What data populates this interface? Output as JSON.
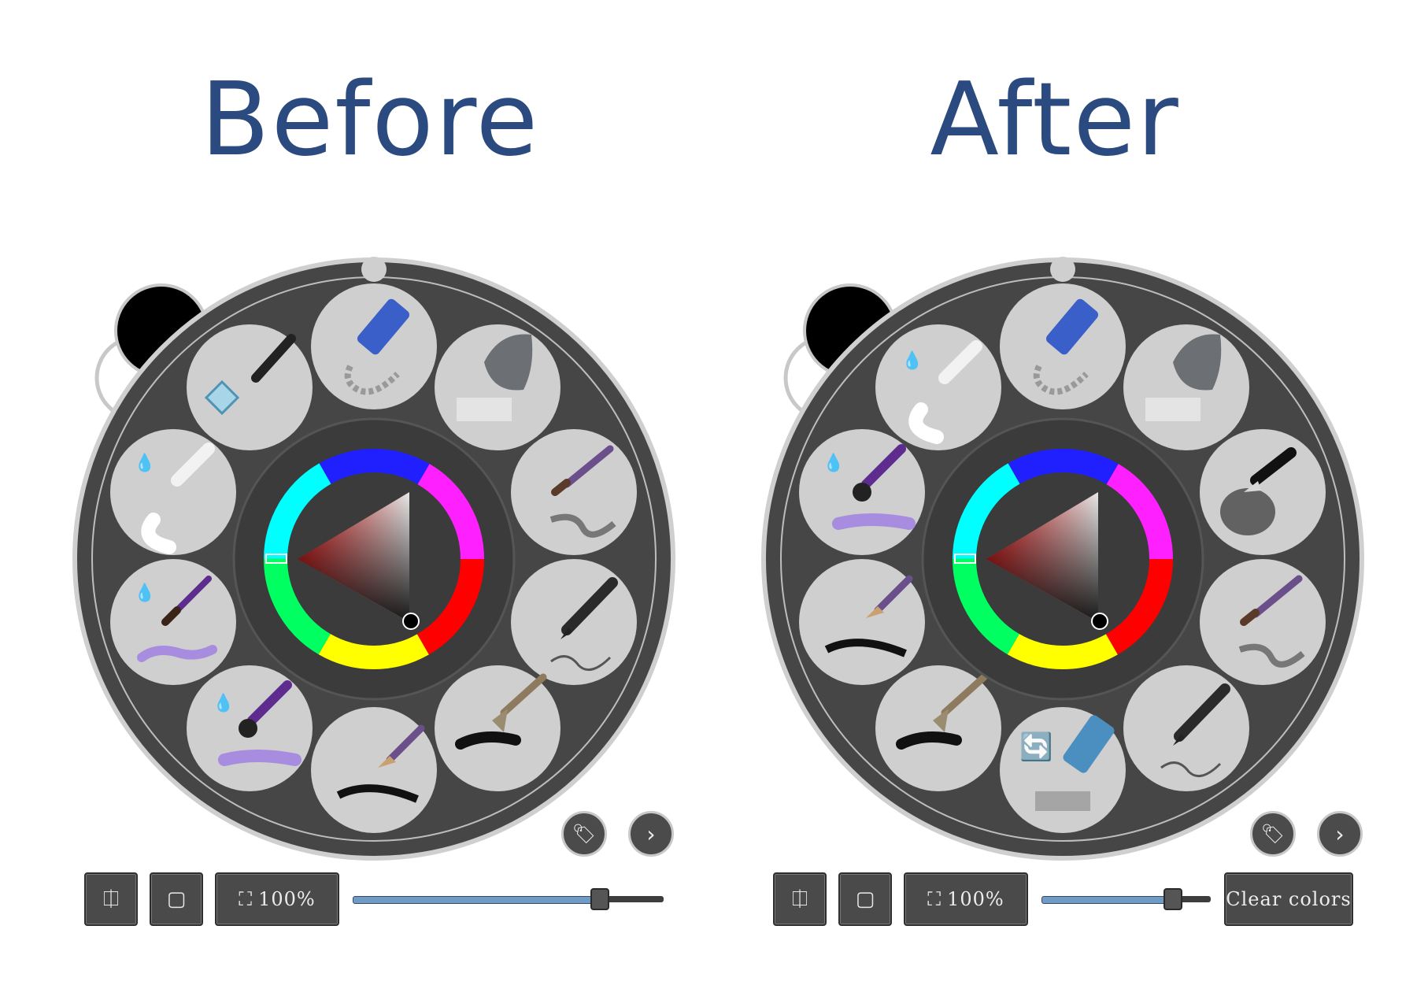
{
  "headings": {
    "before": "Before",
    "after": "After"
  },
  "before": {
    "tools": [
      "pen-tool",
      "eraser-pen",
      "soft-eraser",
      "paint-brush-1",
      "pencil",
      "fan-brush",
      "flat-brush",
      "round-brush-wet",
      "paint-brush-wet",
      "blender-wet"
    ],
    "zoom_label": "100%",
    "slider_value": 0.82
  },
  "after": {
    "tools": [
      "blender-wet",
      "eraser-pen",
      "soft-eraser",
      "airbrush",
      "paint-brush-1",
      "pencil",
      "marker-swap",
      "fan-brush",
      "flat-brush",
      "round-brush-wet"
    ],
    "zoom_label": "100%",
    "slider_value": 0.77,
    "clear_colors_label": "Clear colors"
  },
  "colors": {
    "heading": "#2b4a7f",
    "wheel_bg": "#464646",
    "slot": "#cfcfcf",
    "ring": "#bdbdbd"
  }
}
